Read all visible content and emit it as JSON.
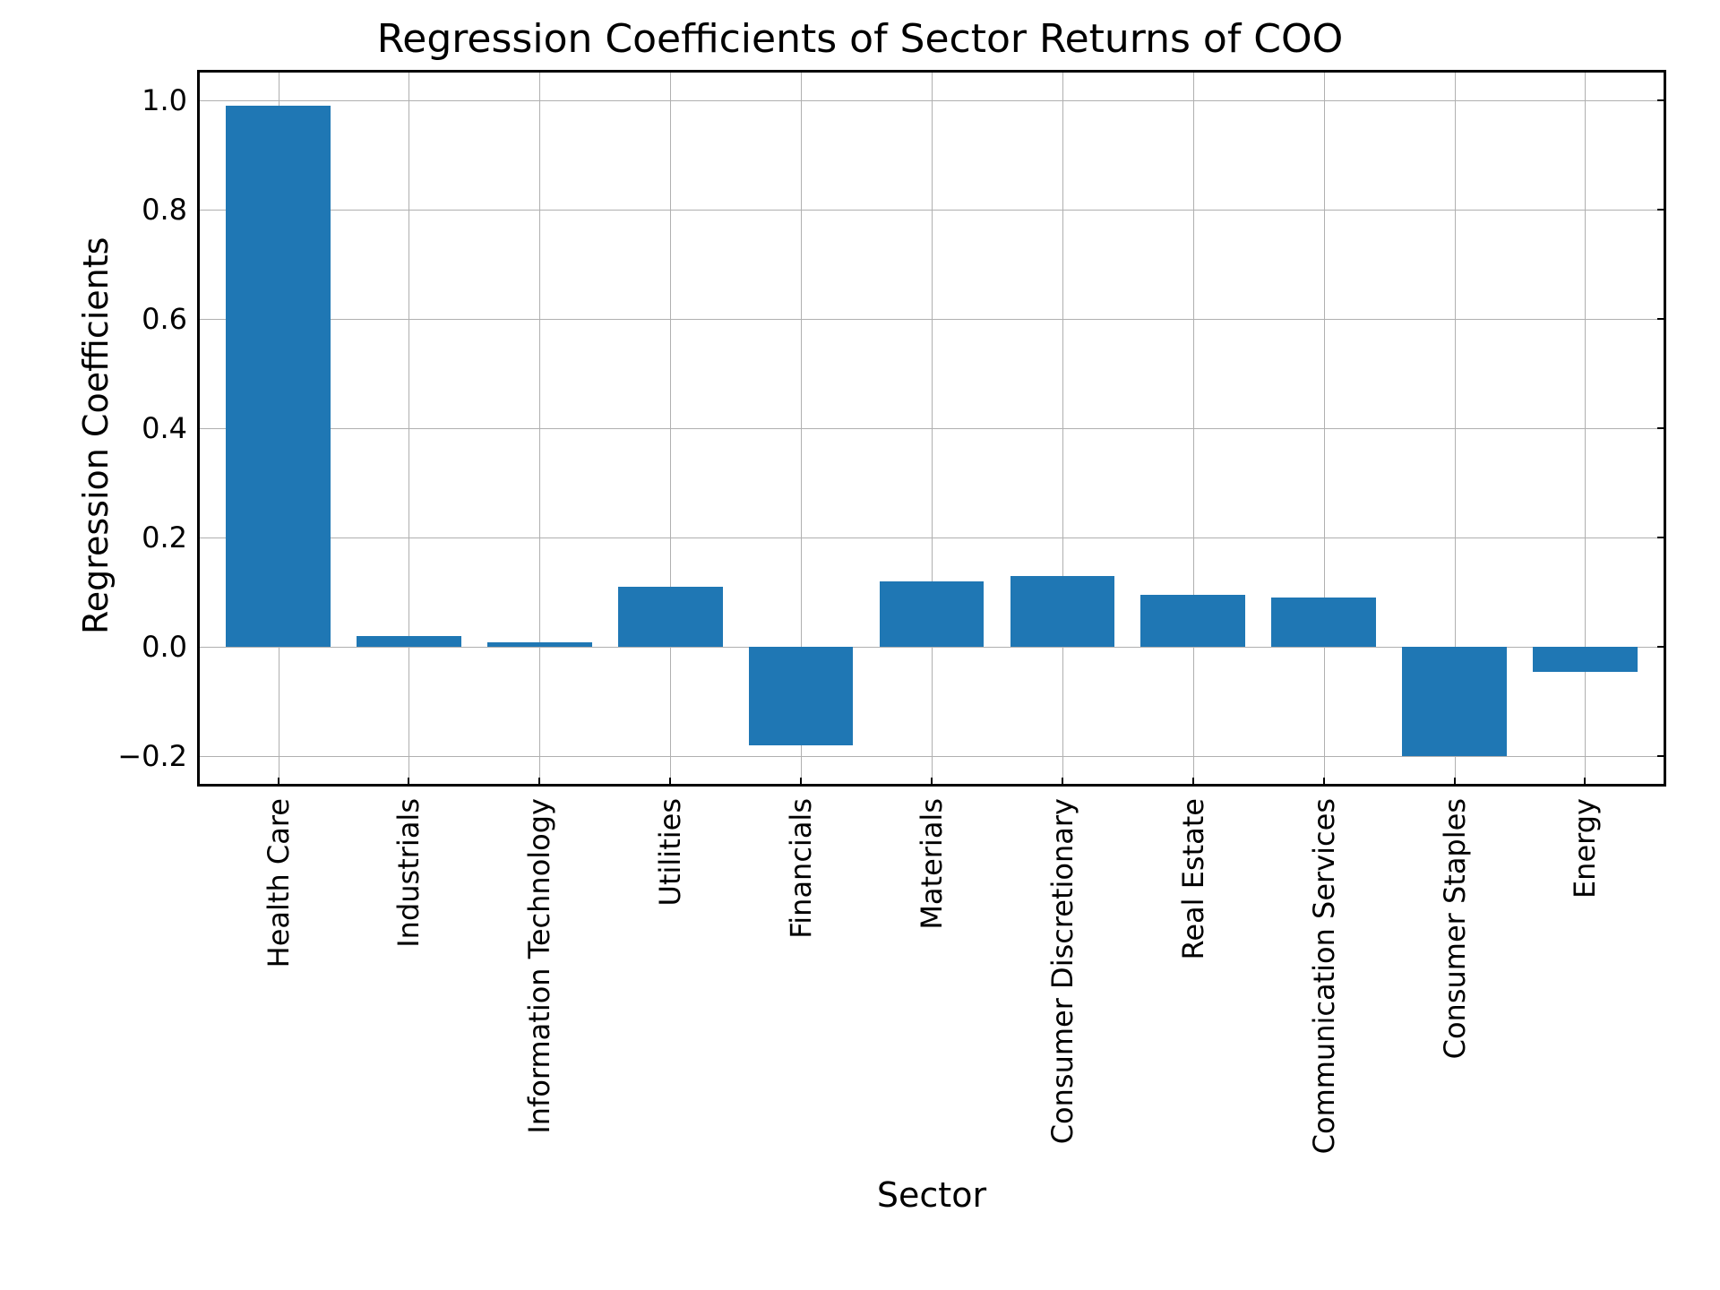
{
  "chart_data": {
    "type": "bar",
    "title": "Regression Coefficients of Sector Returns of COO",
    "xlabel": "Sector",
    "ylabel": "Regression Coefficients",
    "ylim": [
      -0.25,
      1.05
    ],
    "yticks": [
      -0.2,
      0.0,
      0.2,
      0.4,
      0.6,
      0.8,
      1.0
    ],
    "ytick_labels": [
      "−0.2",
      "0.0",
      "0.2",
      "0.4",
      "0.6",
      "0.8",
      "1.0"
    ],
    "categories": [
      "Health Care",
      "Industrials",
      "Information Technology",
      "Utilities",
      "Financials",
      "Materials",
      "Consumer Discretionary",
      "Real Estate",
      "Communication Services",
      "Consumer Staples",
      "Energy"
    ],
    "values": [
      0.99,
      0.02,
      0.009,
      0.11,
      -0.18,
      0.12,
      0.13,
      0.095,
      0.09,
      -0.2,
      -0.045
    ],
    "bar_color": "#1f77b4"
  }
}
